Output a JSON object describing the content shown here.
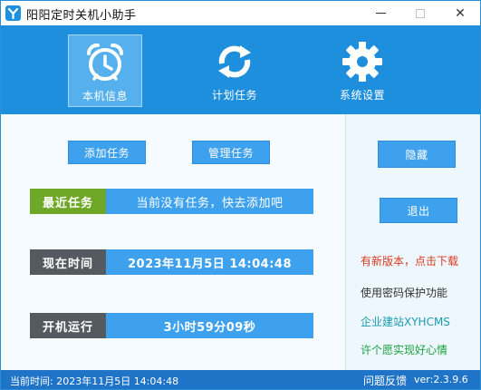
{
  "window": {
    "title": "阳阳定时关机小助手",
    "icon": "app-logo-icon",
    "controls": [
      "minimize-icon",
      "maximize-icon",
      "close-icon"
    ],
    "close_glyph": "✕"
  },
  "nav": {
    "items": [
      {
        "label": "本机信息",
        "icon": "alarm-clock-icon",
        "active": true
      },
      {
        "label": "计划任务",
        "icon": "refresh-arrows-icon",
        "active": false
      },
      {
        "label": "系统设置",
        "icon": "gear-icon",
        "active": false
      }
    ]
  },
  "main": {
    "add_task_label": "添加任务",
    "manage_task_label": "管理任务",
    "recent_task": {
      "label": "最近任务",
      "value": "当前没有任务，快去添加吧"
    },
    "current_time": {
      "label": "现在时间",
      "value": "2023年11月5日 14:04:48"
    },
    "uptime": {
      "label": "开机运行",
      "value": "3小时59分09秒"
    }
  },
  "side": {
    "hide_label": "隐藏",
    "exit_label": "退出",
    "links": {
      "new_version": "有新版本，点击下载",
      "password": "使用密码保护功能",
      "site": "企业建站XYHCMS",
      "wish": "许个愿实现好心情"
    }
  },
  "status": {
    "time_text": "当前时间: 2023年11月5日 14:04:48",
    "feedback": "问题反馈",
    "version": "ver:2.3.9.6"
  },
  "colors": {
    "nav_bg": "#1e8fdc",
    "button_blue": "#3ea1ee",
    "recent_label_green": "#6fa826",
    "label_gray": "#555a60",
    "status_bar": "#1f74c8",
    "link_red": "#d83a1d",
    "link_teal": "#1a9bb0",
    "link_green": "#19a23e"
  }
}
